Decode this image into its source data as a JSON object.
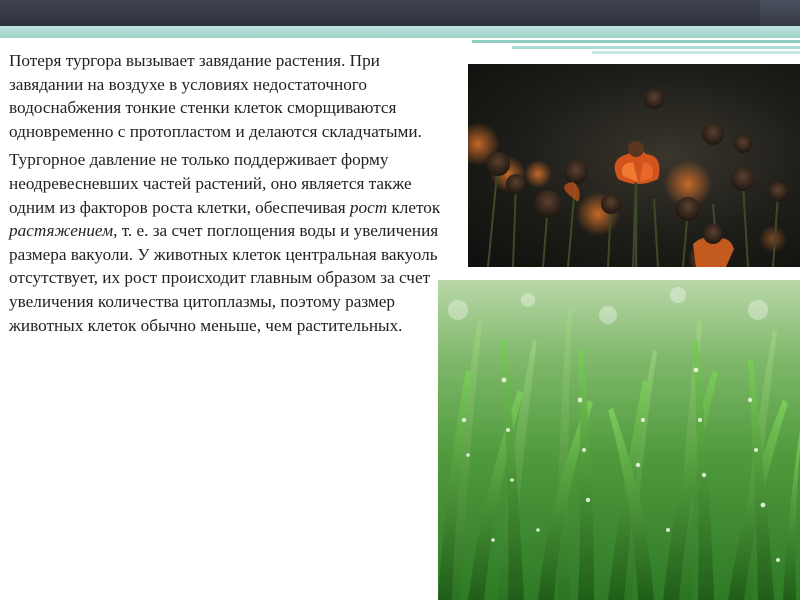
{
  "paragraphs": {
    "p1": "Потеря тургора вызывает завядание растения. При завядании на воздухе в условиях недостаточного водоснабжения тонкие стенки клеток сморщиваются одновременно с протопластом и делаются складчатыми.",
    "p2_part1": "Тургорное давление не только поддерживает форму неодревесневших частей растений, оно является также одним из факторов роста клетки, обеспечивая ",
    "p2_em1": "рост",
    "p2_part2": " клеток ",
    "p2_em2": "растяжением",
    "p2_part3": ", т. е. за счет поглощения воды и увеличения размера вакуоли. У животных клеток центральная вакуоль отсутствует, их рост происходит главным образом за счет увеличения количества цитоплазмы, поэтому размер животных клеток обычно меньше, чем растительных."
  },
  "colors": {
    "top_bar": "#2e323c",
    "teal_accent": "#9fd3ca",
    "text": "#222222"
  }
}
